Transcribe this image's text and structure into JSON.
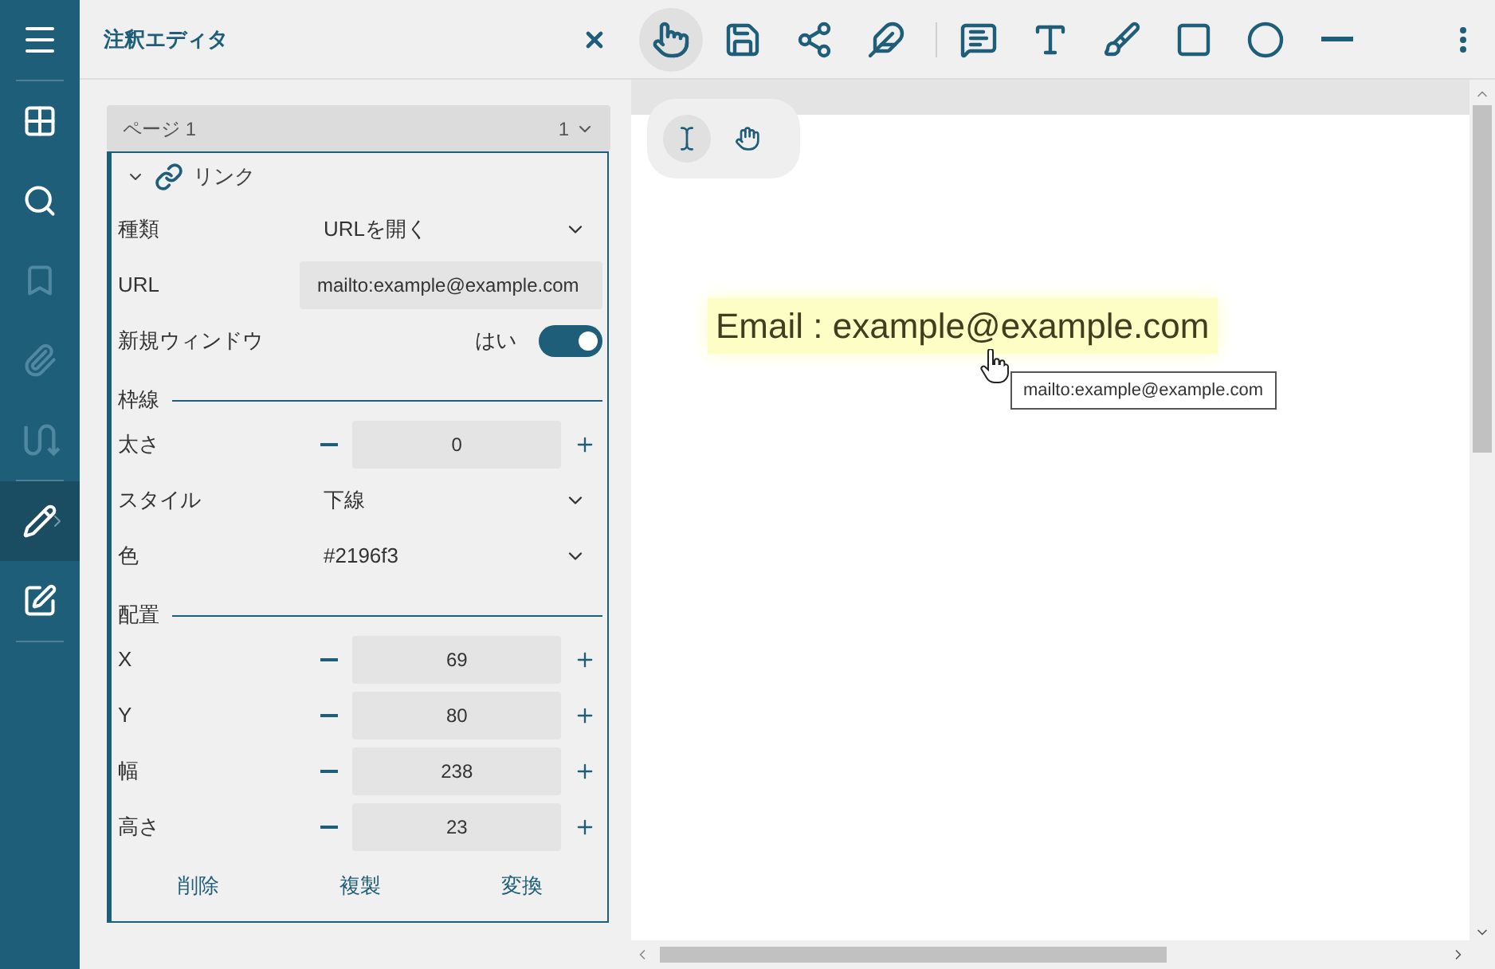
{
  "sidebar": {
    "items": [
      {
        "selected": false,
        "disabled": false
      },
      {
        "selected": false,
        "disabled": false
      },
      {
        "selected": false,
        "disabled": true
      },
      {
        "selected": false,
        "disabled": true
      },
      {
        "selected": false,
        "disabled": true
      },
      {
        "selected": true,
        "disabled": false
      },
      {
        "selected": false,
        "disabled": false
      }
    ]
  },
  "panel": {
    "title": "注釈エディタ",
    "page_select": {
      "label": "ページ 1",
      "value": "1"
    },
    "section": {
      "title": "リンク",
      "expanded": true
    },
    "fields": [
      {
        "kind": "select",
        "label": "種類",
        "value": "URLを開く"
      },
      {
        "kind": "text",
        "label": "URL",
        "value": "mailto:example@example.com"
      },
      {
        "kind": "toggle",
        "label": "新規ウィンドウ",
        "value": "はい",
        "on": true
      },
      {
        "kind": "heading",
        "label": "枠線"
      },
      {
        "kind": "stepper",
        "label": "太さ",
        "value": "0"
      },
      {
        "kind": "select",
        "label": "スタイル",
        "value": "下線"
      },
      {
        "kind": "select",
        "label": "色",
        "value": "#2196f3"
      },
      {
        "kind": "heading",
        "label": "配置"
      },
      {
        "kind": "stepper",
        "label": "X",
        "value": "69"
      },
      {
        "kind": "stepper",
        "label": "Y",
        "value": "80"
      },
      {
        "kind": "stepper",
        "label": "幅",
        "value": "238"
      },
      {
        "kind": "stepper",
        "label": "高さ",
        "value": "23"
      }
    ],
    "actions": [
      "削除",
      "複製",
      "変換"
    ]
  },
  "toolbar": {
    "tools": [
      {
        "selected": true
      },
      {
        "selected": false
      },
      {
        "selected": false
      },
      {
        "selected": false
      },
      {
        "selected": false
      },
      {
        "selected": false
      },
      {
        "selected": false
      },
      {
        "selected": false
      },
      {
        "selected": false
      },
      {
        "selected": false
      }
    ]
  },
  "viewer": {
    "modes": [
      {
        "selected": true
      },
      {
        "selected": false
      }
    ],
    "annotation": {
      "text": "Email : example@example.com"
    },
    "tooltip": "mailto:example@example.com"
  }
}
